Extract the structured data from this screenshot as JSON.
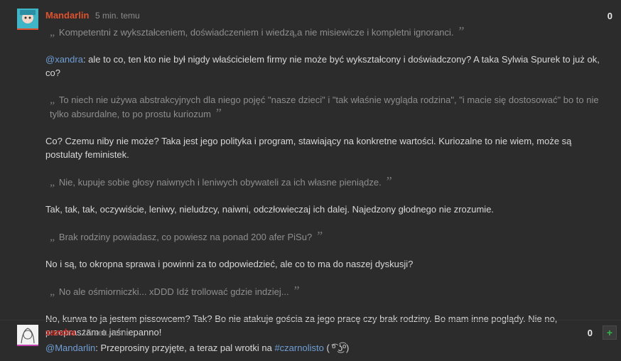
{
  "comments": [
    {
      "author": "Mandarlin",
      "time": "5 min. temu",
      "votes": "0",
      "q1": "Kompetentni z wykształceniem, doświadczeniem i wiedzą,a nie misiewicze i kompletni ignoranci.",
      "p1_mention": "@xandra",
      "p1_text": ": ale to co, ten kto nie był nigdy właścicielem firmy nie może być wykształcony i doświadczony? A taka Sylwia Spurek to już ok, co?",
      "q2": "To niech nie używa abstrakcyjnych dla niego pojęć \"nasze dzieci\" i \"tak właśnie wygląda rodzina\", \"i macie się dostosować\" bo to nie tylko absurdalne, to po prostu kuriozum",
      "p2": "Co? Czemu niby nie może? Taka jest jego polityka i program, stawiający na konkretne wartości. Kuriozalne to nie wiem, może są postulaty feministek.",
      "q3": "Nie, kupuje sobie głosy naiwnych i leniwych obywateli za ich własne pieniądze.",
      "p3": "Tak, tak, tak, oczywiście, leniwy, nieludzcy, naiwni, odczłowieczaj ich dalej. Najedzony głodnego nie zrozumie.",
      "q4": "Brak rodziny powiadasz, co powiesz na ponad 200 afer PiSu?",
      "p4": "No i są, to okropna sprawa i powinni za to odpowiedzieć, ale co to ma do naszej dyskusji?",
      "q5": "No ale ośmiorniczki... xDDD Idź trollować gdzie indziej...",
      "p5": "No, kurwa to ja jestem pissowcem? Tak? Bo nie atakuje gościa za jego pracę czy brak rodziny. Bo mam inne poglądy. Nie no, przepraszam o jaśniepanno!"
    },
    {
      "author": "xandra",
      "time": "15 sek. temu",
      "votes": "0",
      "plus": "+",
      "mention": "@Mandarlin",
      "text": ": Przeprosiny przyjęte, a teraz pal wrotki na ",
      "hashtag": "#czarnolisto",
      "emoticon": " ( ͡º ͜ʖ͡º)"
    }
  ],
  "icons": {
    "quote_open": "„",
    "quote_close": "”",
    "avatar1": "user-avatar-anime",
    "avatar2": "user-avatar-sketch"
  },
  "colors": {
    "author1": "#e0522d",
    "author2": "#c8261e",
    "link": "#6f9fd6",
    "background": "#2c2c2c"
  }
}
